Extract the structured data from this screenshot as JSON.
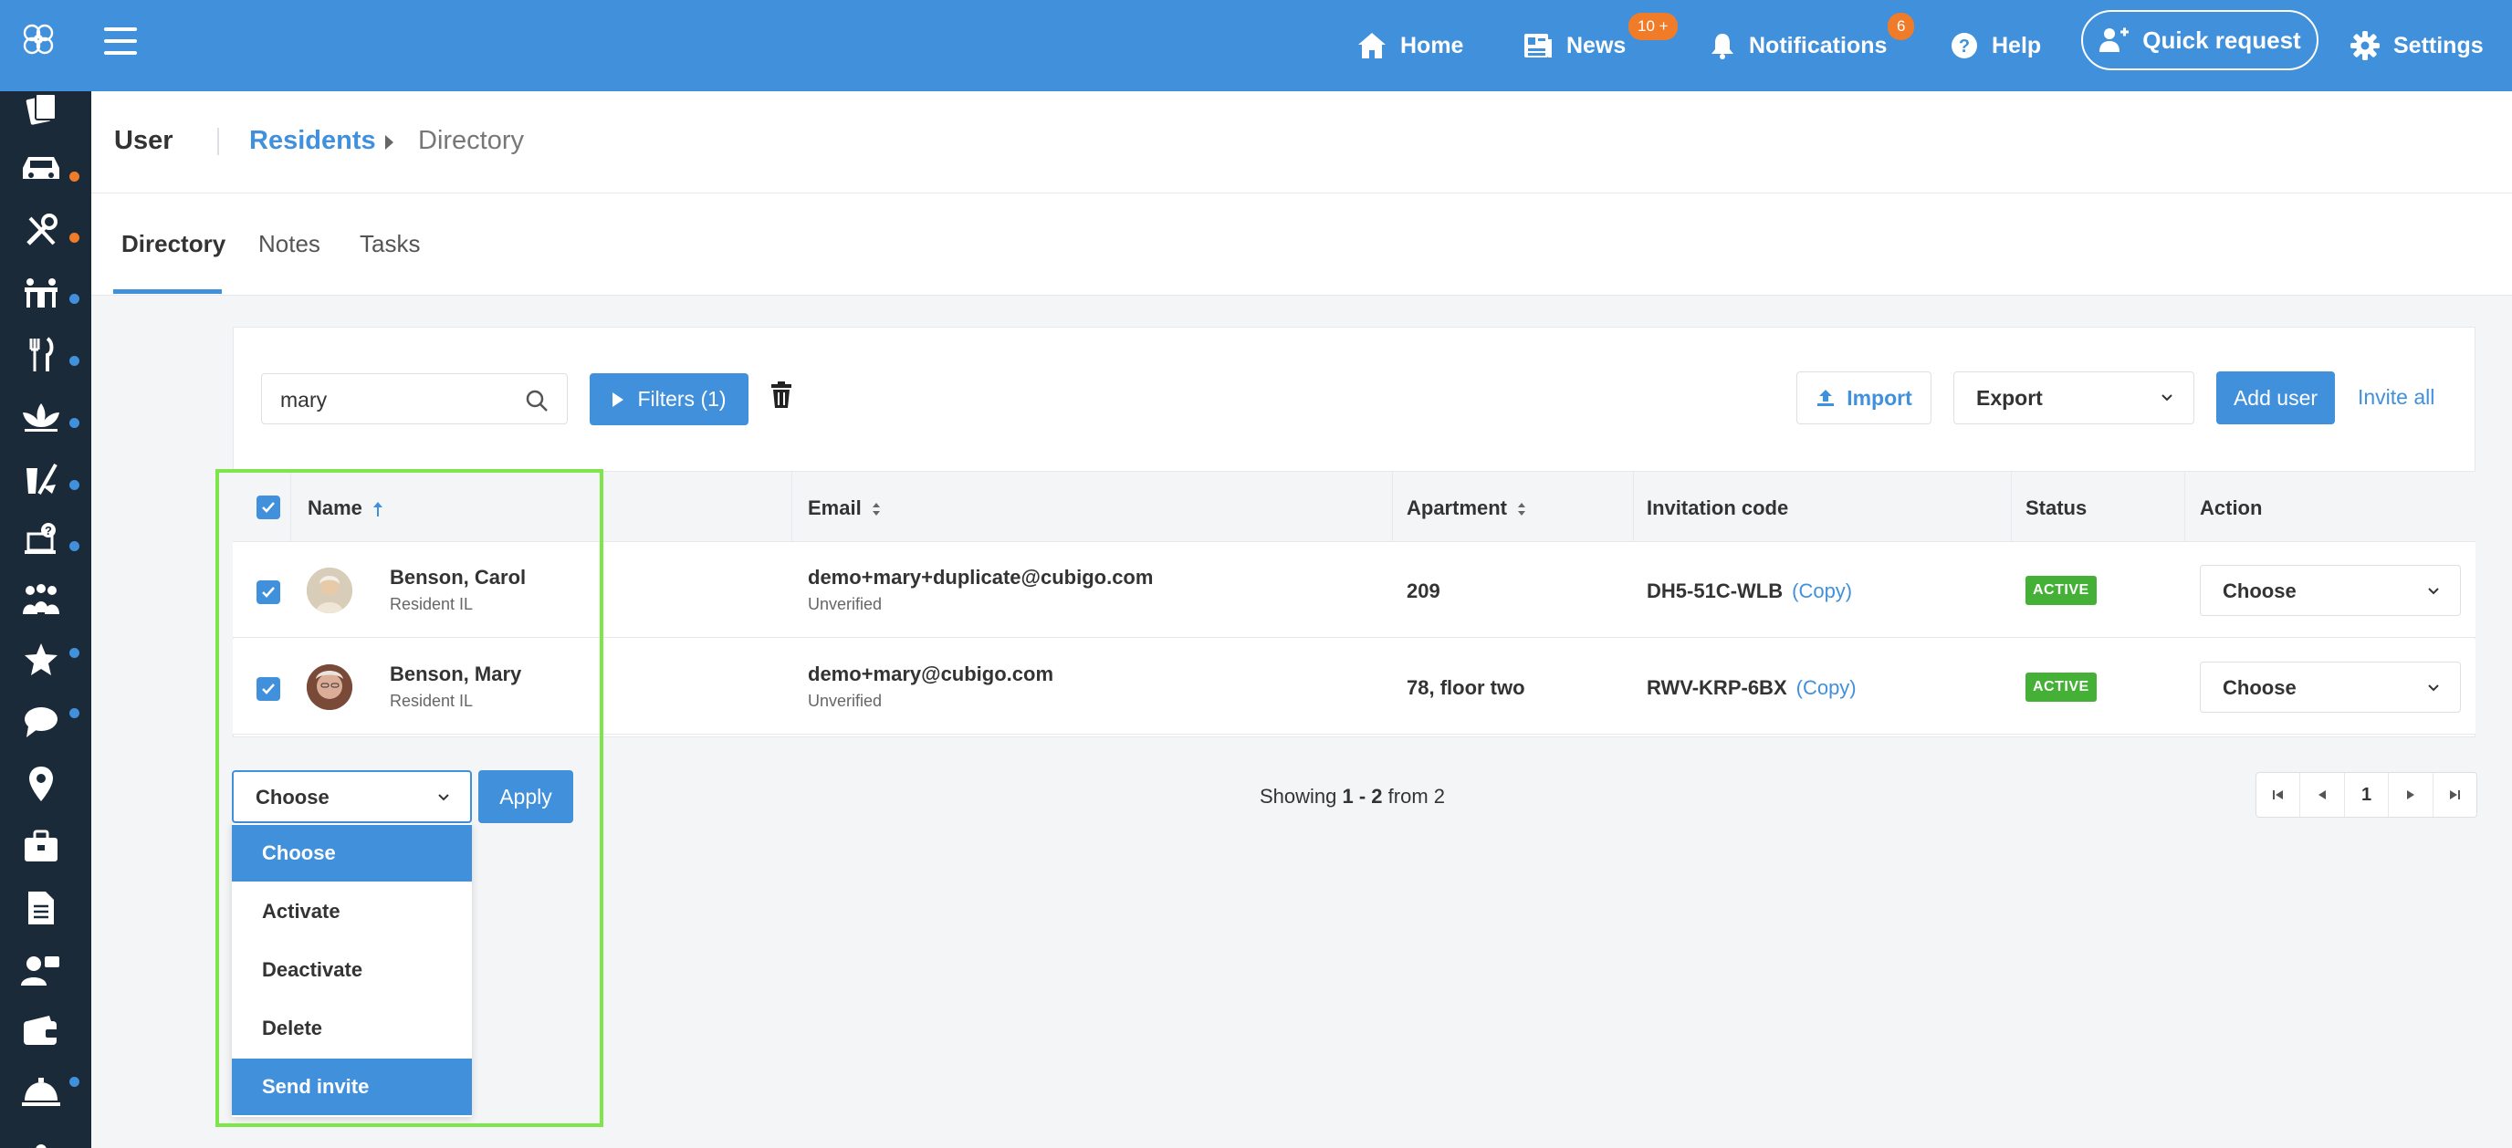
{
  "topbar": {
    "nav": [
      {
        "label": "Home",
        "icon": "home-icon"
      },
      {
        "label": "News",
        "icon": "news-icon",
        "badge": "10 +"
      },
      {
        "label": "Notifications",
        "icon": "bell-icon",
        "badge": "6"
      },
      {
        "label": "Help",
        "icon": "help-icon"
      }
    ],
    "quick_request": "Quick request",
    "settings": "Settings"
  },
  "header": {
    "user": "User",
    "breadcrumb_parent": "Residents",
    "breadcrumb_current": "Directory"
  },
  "tabs": [
    "Directory",
    "Notes",
    "Tasks"
  ],
  "toolbar": {
    "search_value": "mary",
    "filters_label": "Filters (1)",
    "import_label": "Import",
    "export_label": "Export",
    "add_user_label": "Add user",
    "invite_all_label": "Invite all"
  },
  "table": {
    "columns": [
      "Name",
      "Email",
      "Apartment",
      "Invitation code",
      "Status",
      "Action"
    ],
    "rows": [
      {
        "name": "Benson, Carol",
        "role": "Resident IL",
        "email": "demo+mary+duplicate@cubigo.com",
        "email_status": "Unverified",
        "apartment": "209",
        "code": "DH5-51C-WLB",
        "copy": "(Copy)",
        "status": "ACTIVE",
        "action": "Choose"
      },
      {
        "name": "Benson, Mary",
        "role": "Resident IL",
        "email": "demo+mary@cubigo.com",
        "email_status": "Unverified",
        "apartment": "78, floor two",
        "code": "RWV-KRP-6BX",
        "copy": "(Copy)",
        "status": "ACTIVE",
        "action": "Choose"
      }
    ]
  },
  "bulk": {
    "selected": "Choose",
    "apply_label": "Apply",
    "options": [
      "Choose",
      "Activate",
      "Deactivate",
      "Delete",
      "Send invite"
    ]
  },
  "pagination": {
    "showing_prefix": "Showing ",
    "showing_range": "1 - 2",
    "showing_suffix": " from 2",
    "page": "1"
  },
  "colors": {
    "primary": "#4190dc",
    "sidebar": "#1b2a38",
    "status_active": "#44b035",
    "badge": "#f07c2a",
    "highlight": "#7ee64a"
  }
}
